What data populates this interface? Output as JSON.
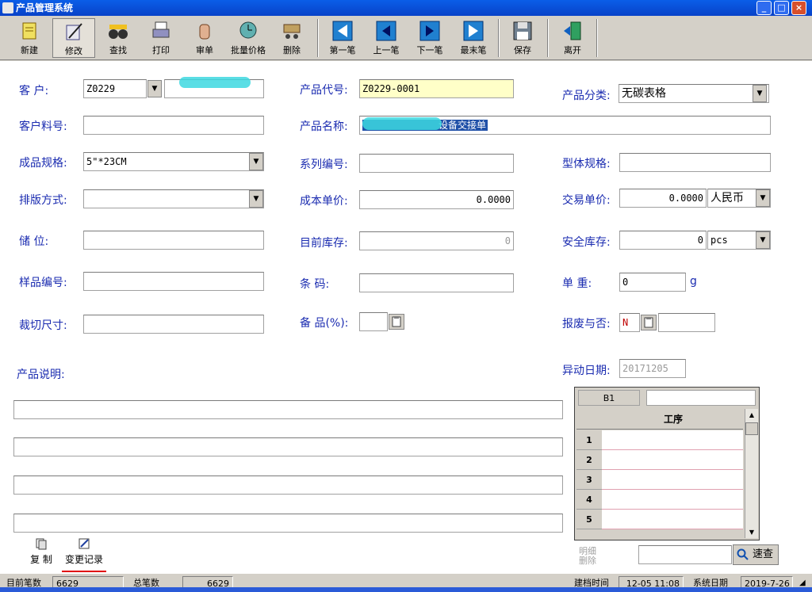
{
  "window": {
    "title": "产品管理系统"
  },
  "toolbar": {
    "buttons": [
      {
        "label": "新建",
        "icon": "new-doc-icon"
      },
      {
        "label": "修改",
        "icon": "edit-pen-icon"
      },
      {
        "label": "查找",
        "icon": "binoculars-icon"
      },
      {
        "label": "打印",
        "icon": "printer-icon"
      },
      {
        "label": "审单",
        "icon": "review-hand-icon"
      },
      {
        "label": "批量价格",
        "icon": "clock-price-icon"
      },
      {
        "label": "删除",
        "icon": "dump-truck-icon"
      },
      {
        "label": "第一笔",
        "icon": "first-record-icon"
      },
      {
        "label": "上一笔",
        "icon": "prev-record-icon"
      },
      {
        "label": "下一笔",
        "icon": "next-record-icon"
      },
      {
        "label": "最末笔",
        "icon": "last-record-icon"
      },
      {
        "label": "保存",
        "icon": "floppy-disk-icon"
      },
      {
        "label": "离开",
        "icon": "exit-door-icon"
      }
    ]
  },
  "form": {
    "customer_label": "客    户:",
    "customer_code": "Z0229",
    "customer_no_label": "客户料号:",
    "customer_no": "",
    "spec_label": "成品规格:",
    "spec": "5\"*23CM",
    "layout_label": "排版方式:",
    "layout": "",
    "storage_label": "储    位:",
    "storage": "",
    "sample_label": "样品编号:",
    "sample": "",
    "cut_label": "裁切尺寸:",
    "cut": "",
    "product_code_label": "产品代号:",
    "product_code": "Z0229-0001",
    "product_name_label": "产品名称:",
    "product_name": "设备交接单",
    "series_label": "系列编号:",
    "series": "",
    "cost_label": "成本单价:",
    "cost": "0.0000",
    "stock_label": "目前库存:",
    "stock": "0",
    "barcode_label": "条    码:",
    "barcode": "",
    "spare_label": "备 品(%):",
    "spare": "",
    "category_label": "产品分类:",
    "category": "无碳表格",
    "form_spec_label": "型体规格:",
    "form_spec": "",
    "trade_label": "交易单价:",
    "trade_price": "0.0000",
    "currency": "人民币",
    "safety_label": "安全库存:",
    "safety": "0",
    "unit": "pcs",
    "weight_label": "单    重:",
    "weight": "0",
    "weight_unit": "g",
    "scrap_label": "报废与否:",
    "scrap": "N",
    "scrap_extra": "",
    "change_date_label": "异动日期:",
    "change_date": "20171205",
    "desc_label": "产品说明:"
  },
  "grid": {
    "cell_ref": "B1",
    "cell_value": "",
    "header": "工序",
    "rows": [
      "1",
      "2",
      "3",
      "4",
      "5"
    ]
  },
  "bottom": {
    "copy_label": "复 制",
    "history_label": "变更记录",
    "detail_delete_label": "明细\n删除",
    "search_value": "",
    "quick_search_label": "速查"
  },
  "status": {
    "current_label": "目前笔数",
    "current": "6629",
    "total_label": "总笔数",
    "total": "6629",
    "created_label": "建档时间",
    "created": "12-05 11:08",
    "sysdate_label": "系统日期",
    "sysdate": "2019-7-26"
  }
}
